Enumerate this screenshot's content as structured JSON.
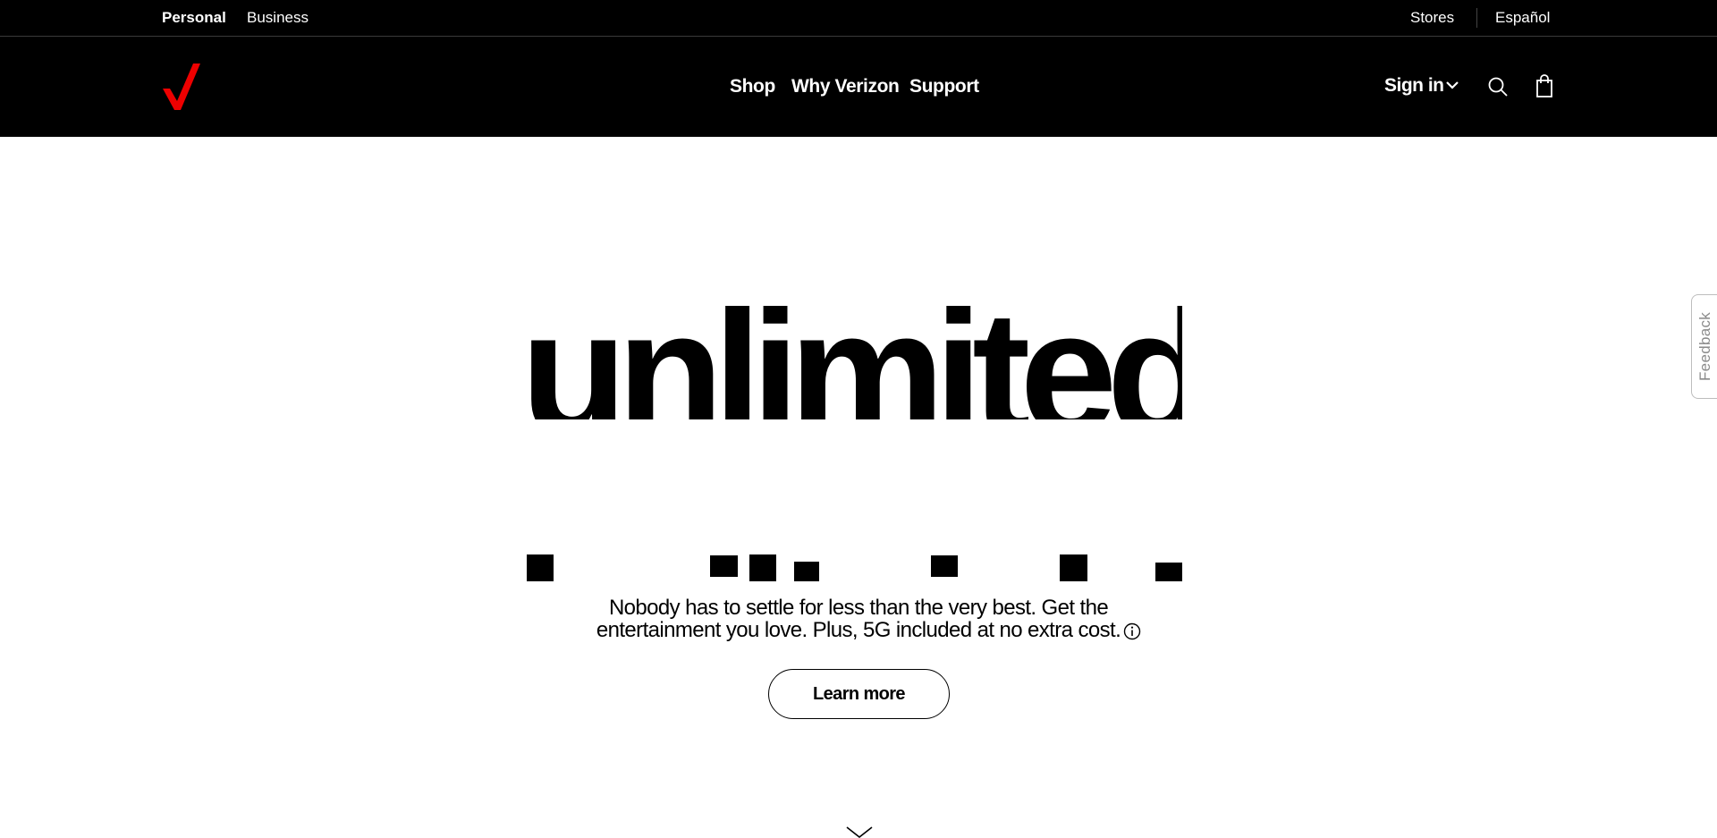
{
  "utility_bar": {
    "personal": "Personal",
    "business": "Business",
    "stores": "Stores",
    "language": "Español"
  },
  "nav": {
    "logo": "verizon-check-logo",
    "shop": "Shop",
    "why_verizon": "Why Verizon",
    "support": "Support",
    "sign_in": "Sign in"
  },
  "hero": {
    "headline": "unlimited",
    "subhead_line1": "Nobody has to settle for less than the very best. Get the",
    "subhead_line2": "entertainment you love. Plus, 5G included at no extra cost.",
    "cta": "Learn more"
  },
  "feedback": "Feedback",
  "colors": {
    "brand_red": "#ee0000",
    "nav_bg": "#000000",
    "page_bg": "#ffffff"
  },
  "icons": [
    "chevron-down-icon",
    "search-icon",
    "shopping-bag-icon",
    "info-icon",
    "scroll-down-chevron-icon"
  ]
}
